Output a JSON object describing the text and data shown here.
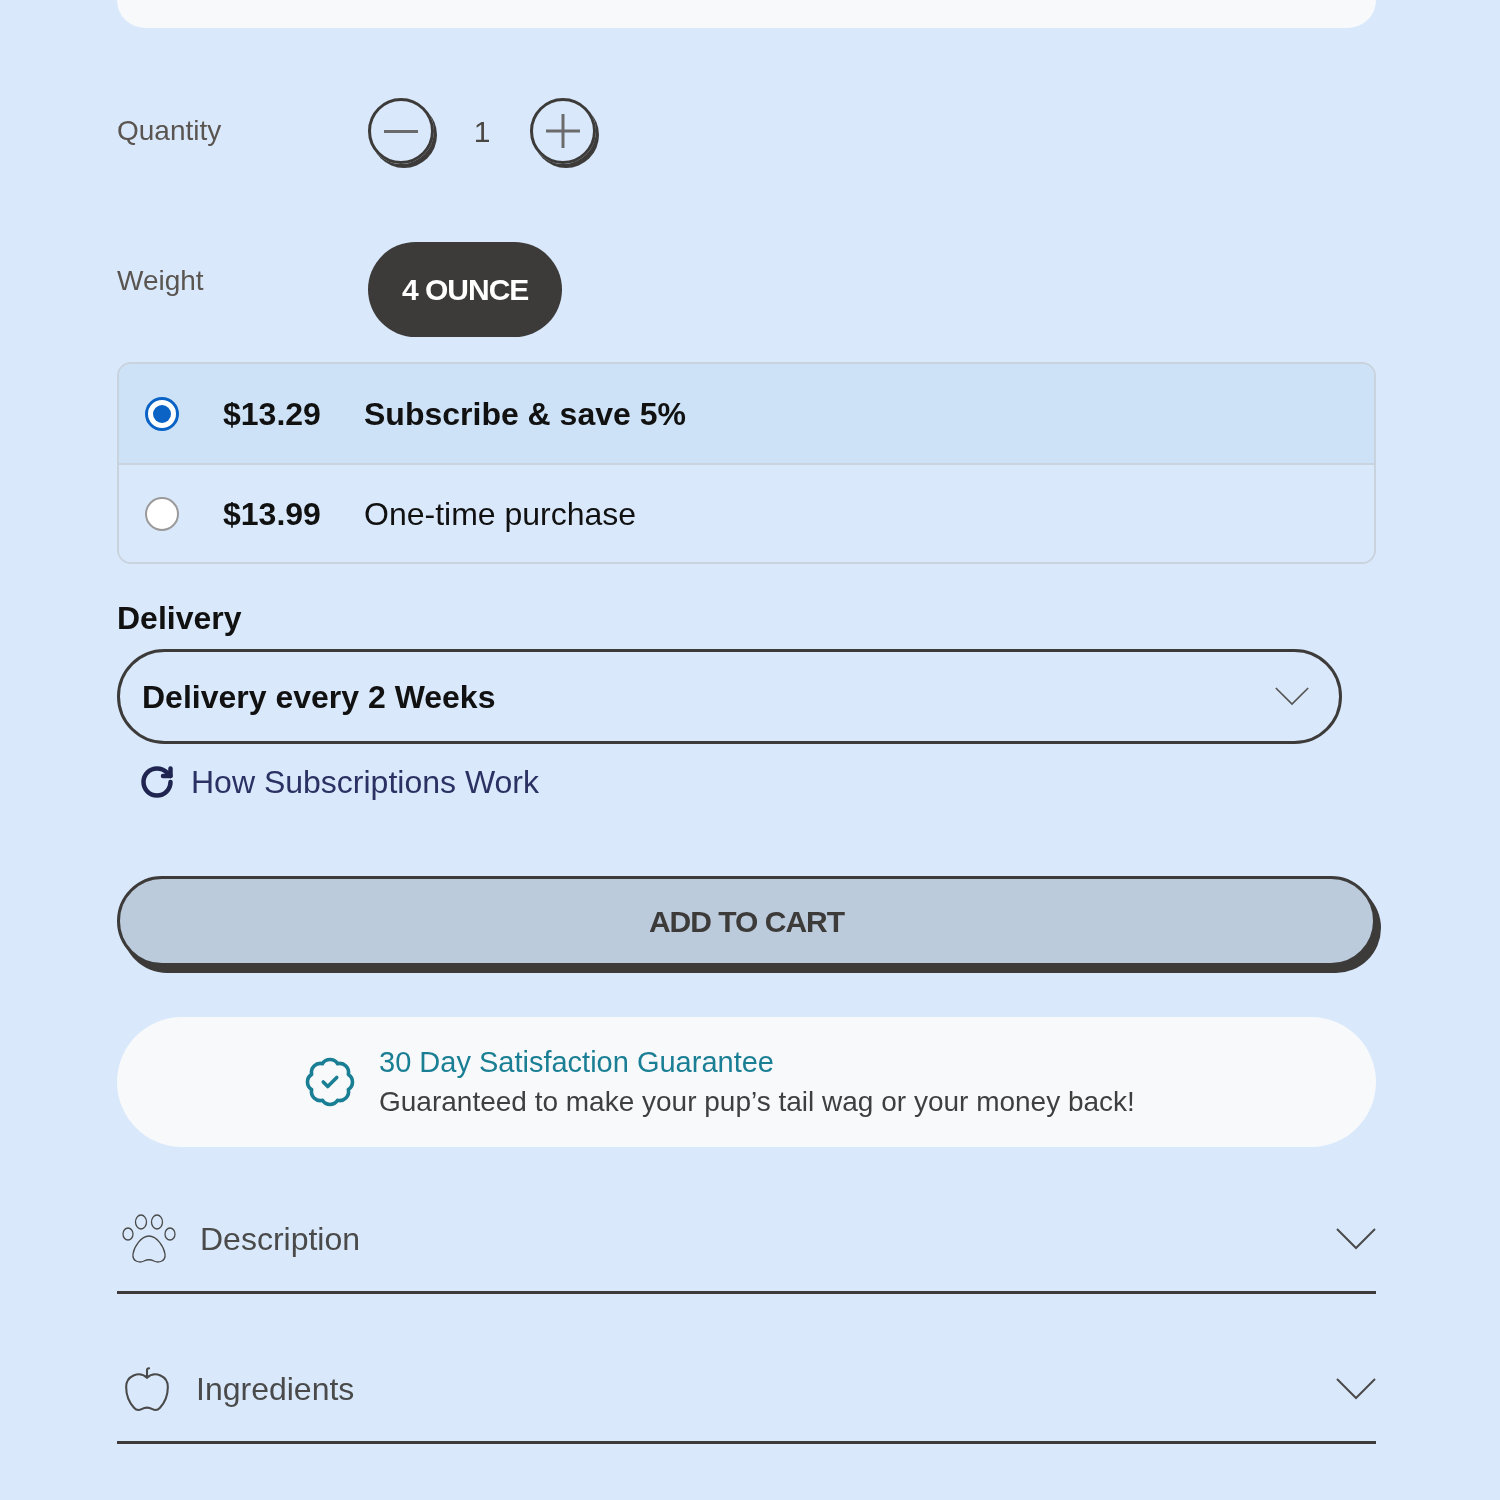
{
  "quantity": {
    "label": "Quantity",
    "value": "1"
  },
  "weight": {
    "label": "Weight",
    "options": [
      {
        "label": "4 OUNCE",
        "selected": true
      }
    ]
  },
  "purchase_options": [
    {
      "price": "$13.29",
      "label": "Subscribe & save 5%",
      "selected": true
    },
    {
      "price": "$13.99",
      "label": "One-time purchase",
      "selected": false
    }
  ],
  "delivery": {
    "label": "Delivery",
    "value": "Delivery every 2 Weeks"
  },
  "subscription_link": "How Subscriptions Work",
  "add_to_cart": "ADD TO CART",
  "guarantee": {
    "title": "30 Day Satisfaction Guarantee",
    "text": "Guaranteed to make your pup’s tail wag or your money back!"
  },
  "accordions": [
    {
      "label": "Description",
      "expanded": false
    },
    {
      "label": "Ingredients",
      "expanded": false
    }
  ]
}
